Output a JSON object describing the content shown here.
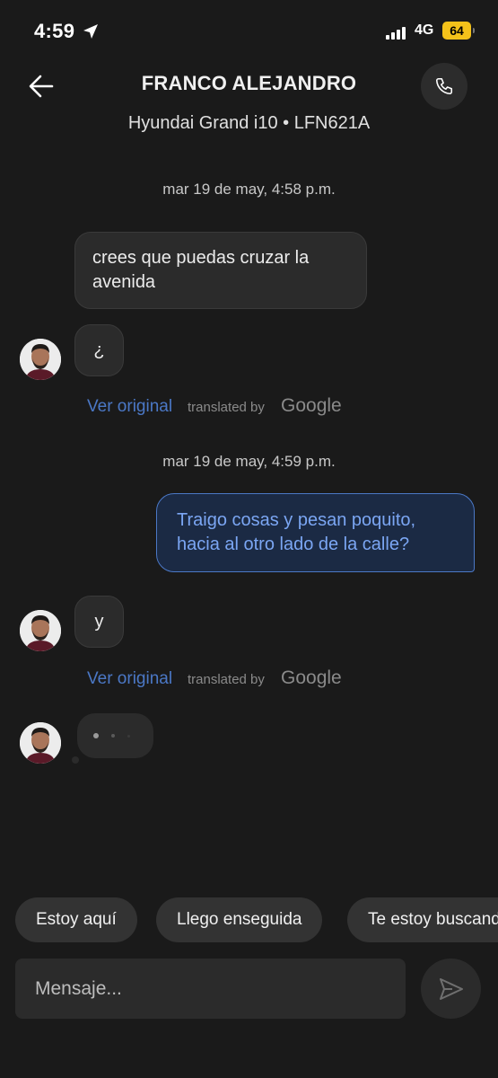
{
  "status_bar": {
    "time": "4:59",
    "network": "4G",
    "battery": "64"
  },
  "header": {
    "driver_name": "FRANCO ALEJANDRO",
    "car_info": "Hyundai Grand i10 • LFN621A"
  },
  "messages": {
    "date_1": "mar 19 de may, 4:58 p.m.",
    "in_1": "crees que puedas cruzar la avenida",
    "in_2": "¿",
    "date_2": "mar 19 de may, 4:59 p.m.",
    "out_1": "Traigo cosas y pesan poquito, hacia al otro lado de la calle?",
    "in_3": "y"
  },
  "translation": {
    "ver_original": "Ver original",
    "translated_by": "translated by",
    "google": "Google"
  },
  "quick_replies": [
    "Estoy aquí",
    "Llego enseguida",
    "Te estoy buscando"
  ],
  "composer": {
    "placeholder": "Mensaje..."
  },
  "colors": {
    "accent": "#4b78c6",
    "background": "#1a1a1a",
    "bubble": "#2b2b2b",
    "battery": "#f4c21a"
  }
}
